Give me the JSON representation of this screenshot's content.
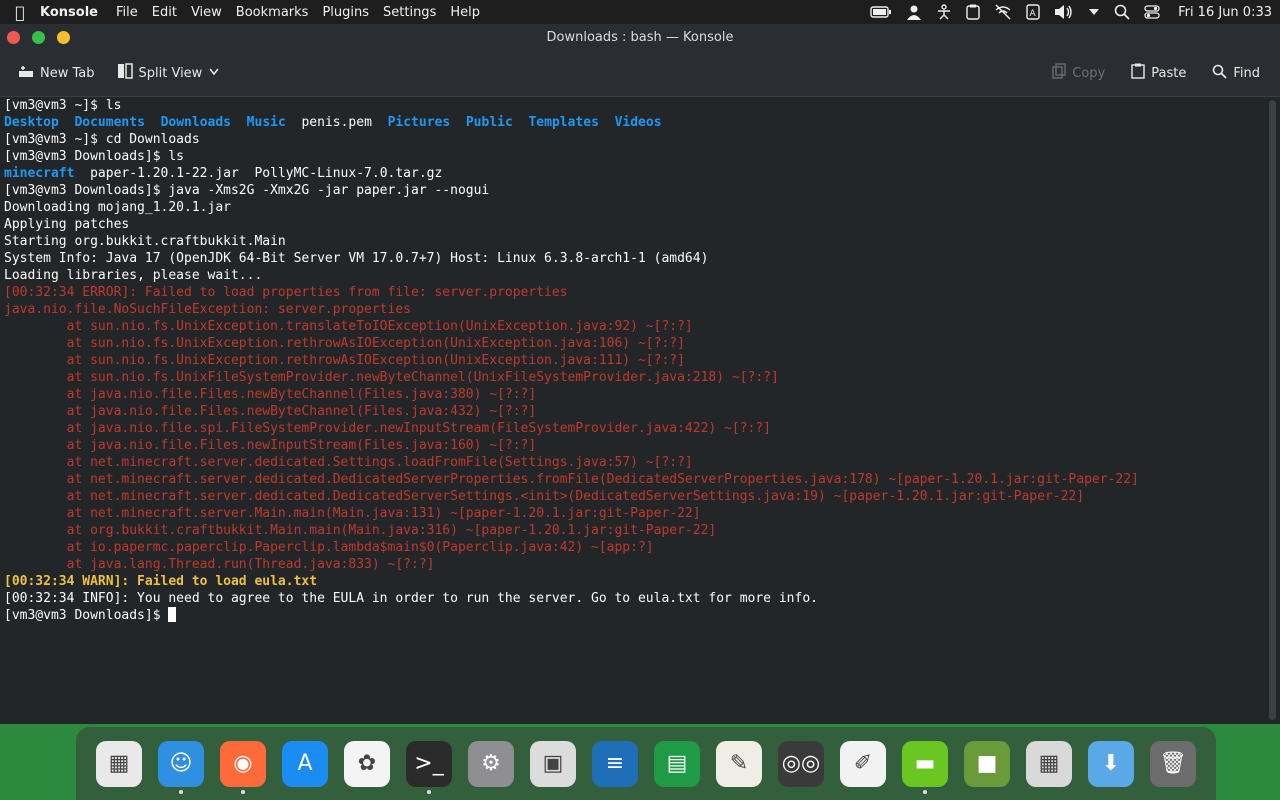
{
  "menubar": {
    "app_name": "Konsole",
    "menus": [
      "File",
      "Edit",
      "View",
      "Bookmarks",
      "Plugins",
      "Settings",
      "Help"
    ],
    "clock": "Fri 16 Jun 0:33"
  },
  "window": {
    "title": "Downloads : bash — Konsole"
  },
  "toolbar": {
    "new_tab": "New Tab",
    "split_view": "Split View",
    "copy": "Copy",
    "paste": "Paste",
    "find": "Find"
  },
  "terminal": {
    "lines": [
      [
        {
          "t": "[vm3@vm3 ~]$ ls",
          "c": ""
        }
      ],
      [
        {
          "t": "Desktop",
          "c": "blue"
        },
        {
          "t": "  ",
          "c": ""
        },
        {
          "t": "Documents",
          "c": "blue"
        },
        {
          "t": "  ",
          "c": ""
        },
        {
          "t": "Downloads",
          "c": "blue"
        },
        {
          "t": "  ",
          "c": ""
        },
        {
          "t": "Music",
          "c": "blue"
        },
        {
          "t": "  penis.pem  ",
          "c": ""
        },
        {
          "t": "Pictures",
          "c": "blue"
        },
        {
          "t": "  ",
          "c": ""
        },
        {
          "t": "Public",
          "c": "blue"
        },
        {
          "t": "  ",
          "c": ""
        },
        {
          "t": "Templates",
          "c": "blue"
        },
        {
          "t": "  ",
          "c": ""
        },
        {
          "t": "Videos",
          "c": "blue"
        }
      ],
      [
        {
          "t": "[vm3@vm3 ~]$ cd Downloads",
          "c": ""
        }
      ],
      [
        {
          "t": "[vm3@vm3 Downloads]$ ls",
          "c": ""
        }
      ],
      [
        {
          "t": "minecraft",
          "c": "blue"
        },
        {
          "t": "  paper-1.20.1-22.jar  PollyMC-Linux-7.0.tar.gz",
          "c": ""
        }
      ],
      [
        {
          "t": "[vm3@vm3 Downloads]$ java -Xms2G -Xmx2G -jar paper.jar --nogui",
          "c": ""
        }
      ],
      [
        {
          "t": "Downloading mojang_1.20.1.jar",
          "c": ""
        }
      ],
      [
        {
          "t": "Applying patches",
          "c": ""
        }
      ],
      [
        {
          "t": "Starting org.bukkit.craftbukkit.Main",
          "c": ""
        }
      ],
      [
        {
          "t": "System Info: Java 17 (OpenJDK 64-Bit Server VM 17.0.7+7) Host: Linux 6.3.8-arch1-1 (amd64)",
          "c": ""
        }
      ],
      [
        {
          "t": "Loading libraries, please wait...",
          "c": ""
        }
      ],
      [
        {
          "t": "[00:32:34 ERROR]: Failed to load properties from file: server.properties",
          "c": "red"
        }
      ],
      [
        {
          "t": "java.nio.file.NoSuchFileException: server.properties",
          "c": "red"
        }
      ],
      [
        {
          "t": "        at sun.nio.fs.UnixException.translateToIOException(UnixException.java:92) ~[?:?]",
          "c": "red"
        }
      ],
      [
        {
          "t": "        at sun.nio.fs.UnixException.rethrowAsIOException(UnixException.java:106) ~[?:?]",
          "c": "red"
        }
      ],
      [
        {
          "t": "        at sun.nio.fs.UnixException.rethrowAsIOException(UnixException.java:111) ~[?:?]",
          "c": "red"
        }
      ],
      [
        {
          "t": "        at sun.nio.fs.UnixFileSystemProvider.newByteChannel(UnixFileSystemProvider.java:218) ~[?:?]",
          "c": "red"
        }
      ],
      [
        {
          "t": "        at java.nio.file.Files.newByteChannel(Files.java:380) ~[?:?]",
          "c": "red"
        }
      ],
      [
        {
          "t": "        at java.nio.file.Files.newByteChannel(Files.java:432) ~[?:?]",
          "c": "red"
        }
      ],
      [
        {
          "t": "        at java.nio.file.spi.FileSystemProvider.newInputStream(FileSystemProvider.java:422) ~[?:?]",
          "c": "red"
        }
      ],
      [
        {
          "t": "        at java.nio.file.Files.newInputStream(Files.java:160) ~[?:?]",
          "c": "red"
        }
      ],
      [
        {
          "t": "        at net.minecraft.server.dedicated.Settings.loadFromFile(Settings.java:57) ~[?:?]",
          "c": "red"
        }
      ],
      [
        {
          "t": "        at net.minecraft.server.dedicated.DedicatedServerProperties.fromFile(DedicatedServerProperties.java:178) ~[paper-1.20.1.jar:git-Paper-22]",
          "c": "red"
        }
      ],
      [
        {
          "t": "        at net.minecraft.server.dedicated.DedicatedServerSettings.<init>(DedicatedServerSettings.java:19) ~[paper-1.20.1.jar:git-Paper-22]",
          "c": "red"
        }
      ],
      [
        {
          "t": "        at net.minecraft.server.Main.main(Main.java:131) ~[paper-1.20.1.jar:git-Paper-22]",
          "c": "red"
        }
      ],
      [
        {
          "t": "        at org.bukkit.craftbukkit.Main.main(Main.java:316) ~[paper-1.20.1.jar:git-Paper-22]",
          "c": "red"
        }
      ],
      [
        {
          "t": "        at io.papermc.paperclip.Paperclip.lambda$main$0(Paperclip.java:42) ~[app:?]",
          "c": "red"
        }
      ],
      [
        {
          "t": "        at java.lang.Thread.run(Thread.java:833) ~[?:?]",
          "c": "red"
        }
      ],
      [
        {
          "t": "[00:32:34 WARN]: Failed to load eula.txt",
          "c": "warn"
        }
      ],
      [
        {
          "t": "[00:32:34 INFO]: You need to agree to the EULA in order to run the server. Go to eula.txt for more info.",
          "c": ""
        }
      ],
      [
        {
          "t": "[vm3@vm3 Downloads]$ ",
          "c": ""
        }
      ]
    ]
  },
  "dock": {
    "apps": [
      {
        "name": "launchpad",
        "icon": "grid-icon",
        "bg": "#e9e9e9",
        "glyph": "▦",
        "running": false
      },
      {
        "name": "finder",
        "icon": "finder-icon",
        "bg": "#2f8fe0",
        "glyph": "☺",
        "running": true
      },
      {
        "name": "firefox",
        "icon": "firefox-icon",
        "bg": "#ff6a3a",
        "glyph": "◉",
        "running": true
      },
      {
        "name": "app-store",
        "icon": "appstore-icon",
        "bg": "#1b8cf2",
        "glyph": "A",
        "running": false
      },
      {
        "name": "photos",
        "icon": "photos-icon",
        "bg": "#f4f4f4",
        "glyph": "✿",
        "running": false
      },
      {
        "name": "terminal",
        "icon": "terminal-icon",
        "bg": "#2b2b2b",
        "glyph": ">_",
        "running": true
      },
      {
        "name": "system-preferences",
        "icon": "gear-icon",
        "bg": "#8e8e93",
        "glyph": "⚙",
        "running": false
      },
      {
        "name": "preview",
        "icon": "preview-icon",
        "bg": "#dcdcdc",
        "glyph": "▣",
        "running": false
      },
      {
        "name": "writer",
        "icon": "document-icon",
        "bg": "#1f6fb8",
        "glyph": "≡",
        "running": false
      },
      {
        "name": "calc",
        "icon": "spreadsheet-icon",
        "bg": "#1f9a45",
        "glyph": "▤",
        "running": false
      },
      {
        "name": "draw",
        "icon": "draw-icon",
        "bg": "#f0ede7",
        "glyph": "✎",
        "running": false
      },
      {
        "name": "cassette",
        "icon": "cassette-icon",
        "bg": "#3a3a3a",
        "glyph": "◎◎",
        "running": false
      },
      {
        "name": "text-editor",
        "icon": "notepad-icon",
        "bg": "#f2f2f2",
        "glyph": "✐",
        "running": false
      },
      {
        "name": "pollymc",
        "icon": "pollymc-icon",
        "bg": "#6ac721",
        "glyph": "▬",
        "running": true
      },
      {
        "name": "minecraft",
        "icon": "minecraft-block-icon",
        "bg": "#6a9b3a",
        "glyph": "■",
        "running": false
      },
      {
        "name": "calculator",
        "icon": "calculator-icon",
        "bg": "#d9d9d9",
        "glyph": "▦",
        "running": false
      },
      {
        "name": "downloads-folder",
        "icon": "folder-download-icon",
        "bg": "#5aa8e8",
        "glyph": "⬇",
        "running": false
      },
      {
        "name": "trash",
        "icon": "trash-icon",
        "bg": "#6c6c6c",
        "glyph": "🗑",
        "running": false
      }
    ]
  }
}
